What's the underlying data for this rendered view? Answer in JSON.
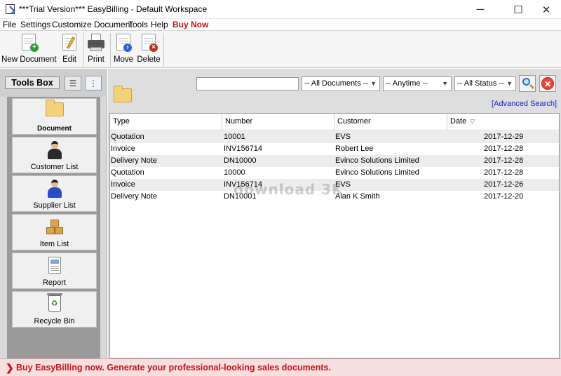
{
  "window": {
    "title": "***Trial Version*** EasyBilling - Default Workspace",
    "minimize": "─",
    "maximize": "☐",
    "close": "✕"
  },
  "menu": {
    "items": [
      "File",
      "Settings",
      "Customize Document",
      "Tools",
      "Help",
      "Buy Now"
    ]
  },
  "toolbar": {
    "new_document": "New Document",
    "edit": "Edit",
    "print": "Print",
    "move": "Move",
    "delete": "Delete"
  },
  "sidebar": {
    "toolsbox_label": "Tools Box",
    "items": [
      {
        "label": "Document",
        "icon": "folder-icon"
      },
      {
        "label": "Customer List",
        "icon": "customer-icon"
      },
      {
        "label": "Supplier List",
        "icon": "supplier-icon"
      },
      {
        "label": "Item List",
        "icon": "boxes-icon"
      },
      {
        "label": "Report",
        "icon": "report-icon"
      },
      {
        "label": "Recycle Bin",
        "icon": "recycle-bin-icon"
      }
    ]
  },
  "filters": {
    "search_value": "",
    "documents": "-- All Documents --",
    "time": "-- Anytime --",
    "status": "-- All Status --",
    "advanced_search": "[Advanced Search]"
  },
  "table": {
    "columns": [
      "Type",
      "Number",
      "Customer",
      "Date"
    ],
    "sort_indicator": "▽",
    "rows": [
      {
        "type": "Quotation",
        "number": "10001",
        "customer": "EVS",
        "date": "2017-12-29"
      },
      {
        "type": "Invoice",
        "number": "INV156714",
        "customer": "Robert Lee",
        "date": "2017-12-28"
      },
      {
        "type": "Delivery Note",
        "number": "DN10000",
        "customer": "Evinco Solutions Limited",
        "date": "2017-12-28"
      },
      {
        "type": "Quotation",
        "number": "10000",
        "customer": "Evinco Solutions Limited",
        "date": "2017-12-28"
      },
      {
        "type": "Invoice",
        "number": "INV156714",
        "customer": "EVS",
        "date": "2017-12-26"
      },
      {
        "type": "Delivery Note",
        "number": "DN10001",
        "customer": "Alan K Smith",
        "date": "2017-12-20"
      }
    ]
  },
  "watermark": "download 3K",
  "status": {
    "chevron": "❯",
    "message": "Buy EasyBilling now. Generate your professional-looking sales documents."
  },
  "colors": {
    "buy_now": "#c0161a",
    "status_bg": "#f8dede",
    "link": "#1a1ad0"
  }
}
